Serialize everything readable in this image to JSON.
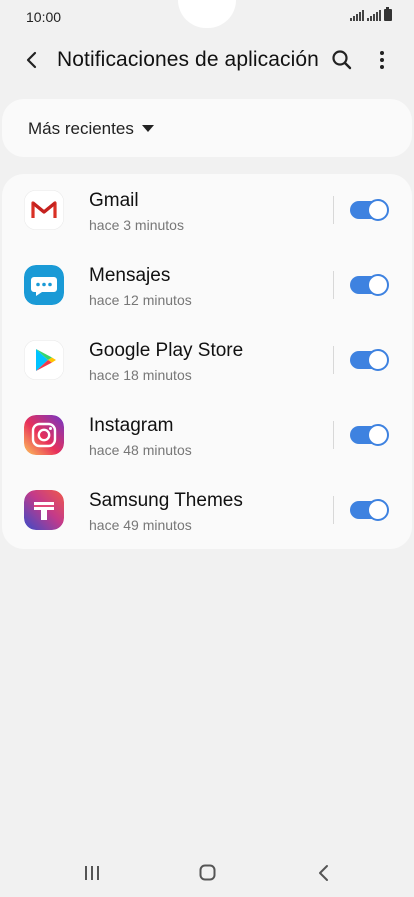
{
  "status_bar": {
    "time": "10:00"
  },
  "header": {
    "title": "Notificaciones de aplicación"
  },
  "sort": {
    "label": "Más recientes"
  },
  "apps": [
    {
      "name": "Gmail",
      "time": "hace 3 minutos",
      "enabled": true,
      "icon": "gmail-icon"
    },
    {
      "name": "Mensajes",
      "time": "hace 12 minutos",
      "enabled": true,
      "icon": "messages-icon"
    },
    {
      "name": "Google Play Store",
      "time": "hace 18 minutos",
      "enabled": true,
      "icon": "play-store-icon"
    },
    {
      "name": "Instagram",
      "time": "hace 48 minutos",
      "enabled": true,
      "icon": "instagram-icon"
    },
    {
      "name": "Samsung Themes",
      "time": "hace 49 minutos",
      "enabled": true,
      "icon": "samsung-themes-icon"
    }
  ],
  "colors": {
    "accent": "#3e82e0",
    "background": "#f1f1f1",
    "card": "#fafafa"
  }
}
